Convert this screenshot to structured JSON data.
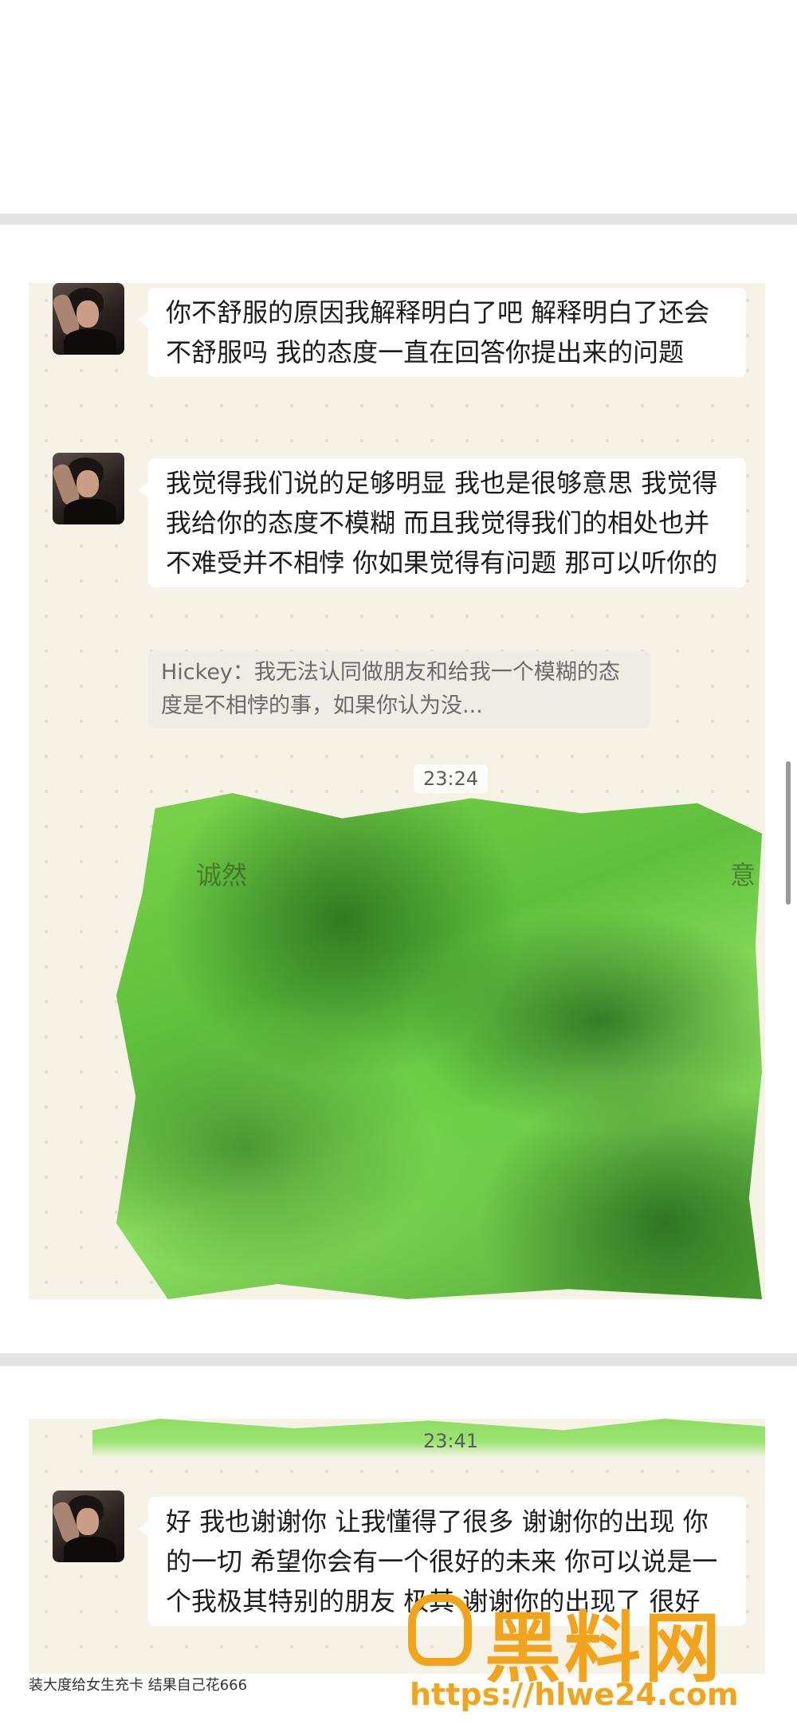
{
  "messages": {
    "msg1": "你不舒服的原因我解释明白了吧 解释明白了还会不舒服吗 我的态度一直在回答你提出来的问题",
    "msg2": "我觉得我们说的足够明显 我也是很够意思 我觉得我给你的态度不模糊 而且我觉得我们的相处也并不难受并不相悖 你如果觉得有问题 那可以听你的",
    "quote": "Hickey：我无法认同做朋友和给我一个模糊的态度是不相悖的事，如果你认为没...",
    "time1": "23:24",
    "ghost_left": "诚然",
    "ghost_right": "意",
    "time2": "23:41",
    "msg3": "好 我也谢谢你 让我懂得了很多 谢谢你的出现 你的一切 希望你会有一个很好的未来 你可以说是一个我极其特别的朋友 极其 谢谢你的出现了 很好"
  },
  "caption": "装大度给女生充卡 结果自己花666",
  "watermark": {
    "brand": "黑料网",
    "url": "https://hlwe24.com"
  },
  "colors": {
    "panel_bg": "#f6f2e6",
    "scribble_green": "#6ccb45",
    "watermark_orange": "#f2a41c"
  }
}
